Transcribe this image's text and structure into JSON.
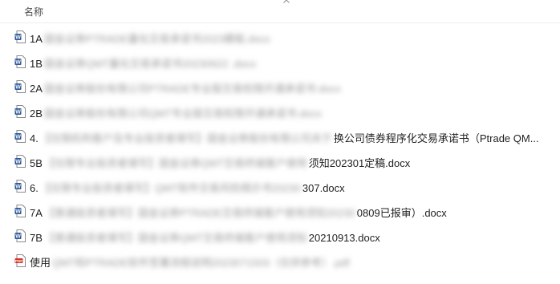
{
  "header": {
    "name_column": "名称"
  },
  "files": [
    {
      "icon": "word-doc-icon",
      "prefix": "1A",
      "obscured": "国金证券PTRADE量化交易承诺书2023模板.docx",
      "suffix": ""
    },
    {
      "icon": "word-doc-icon",
      "prefix": "1B",
      "obscured": "国金证券QMT量化交易承诺书20230622 .docx",
      "suffix": ""
    },
    {
      "icon": "word-doc-icon",
      "prefix": "2A",
      "obscured": "国金证券股份有限公司PTRADE专业版交易权限开通承诺书.docx",
      "suffix": ""
    },
    {
      "icon": "word-doc-icon",
      "prefix": "2B",
      "obscured": "国金证券股份有限公司QMT专业版交易权限开通承诺书.docx",
      "suffix": ""
    },
    {
      "icon": "word-doc-icon",
      "prefix": "4.",
      "obscured": "【仅限机构客户及专业投资者填写】国金证券股份有限公司关于",
      "suffix": "换公司债券程序化交易承诺书（Ptrade QM..."
    },
    {
      "icon": "word-doc-icon",
      "prefix": "5B",
      "obscured": "【仅限专业投资者填写】国金证券QMT交易终端客户使用",
      "suffix": "须知202301定稿.docx"
    },
    {
      "icon": "word-doc-icon",
      "prefix": "6.",
      "obscured": "【仅限专业投资者填写】QMT软件交易风险揭示书20230",
      "suffix": "307.docx"
    },
    {
      "icon": "word-doc-icon",
      "prefix": "7A",
      "obscured": "【普通投资者填写】国金证券PTRADE交易终端客户使用须知20230",
      "suffix": "0809已报审）.docx"
    },
    {
      "icon": "word-doc-icon",
      "prefix": "7B",
      "obscured": "【普通投资者填写】国金证券QMT交易终端客户使用须知",
      "suffix": "20210913.docx"
    },
    {
      "icon": "pdf-icon",
      "prefix": "使用",
      "obscured": "QMT和PTRADE软件签署流程说明2023071503（仅供参考）.pdf",
      "suffix": ""
    }
  ],
  "colors": {
    "word_blue": "#2b579a",
    "pdf_red": "#d93025"
  }
}
